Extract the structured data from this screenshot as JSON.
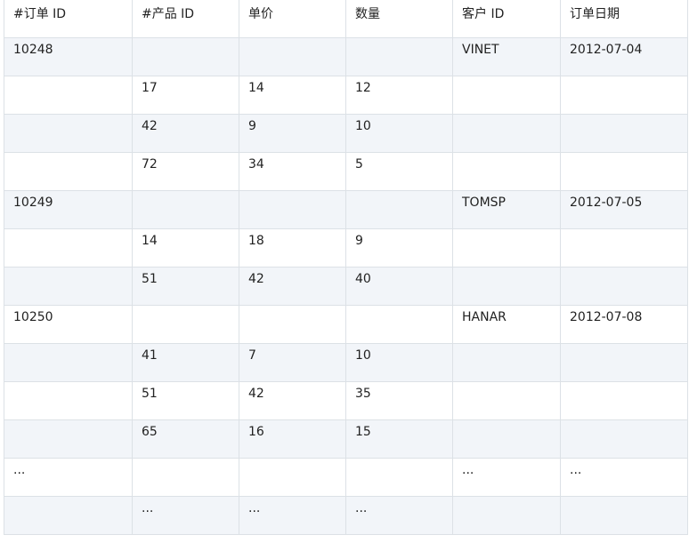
{
  "table": {
    "headers": [
      "#订单 ID",
      "#产品 ID",
      "单价",
      "数量",
      "客户 ID",
      "订单日期"
    ],
    "rows": [
      [
        "10248",
        "",
        "",
        "",
        "VINET",
        "2012-07-04"
      ],
      [
        "",
        "17",
        "14",
        "12",
        "",
        ""
      ],
      [
        "",
        "42",
        "9",
        "10",
        "",
        ""
      ],
      [
        "",
        "72",
        "34",
        "5",
        "",
        ""
      ],
      [
        "10249",
        "",
        "",
        "",
        "TOMSP",
        "2012-07-05"
      ],
      [
        "",
        "14",
        "18",
        "9",
        "",
        ""
      ],
      [
        "",
        "51",
        "42",
        "40",
        "",
        ""
      ],
      [
        "10250",
        "",
        "",
        "",
        "HANAR",
        "2012-07-08"
      ],
      [
        "",
        "41",
        "7",
        "10",
        "",
        ""
      ],
      [
        "",
        "51",
        "42",
        "35",
        "",
        ""
      ],
      [
        "",
        "65",
        "16",
        "15",
        "",
        ""
      ],
      [
        "...",
        "",
        "",
        "",
        "...",
        "..."
      ],
      [
        "",
        "...",
        "...",
        "...",
        "",
        ""
      ]
    ]
  },
  "colors": {
    "stripe": "#f2f5f9",
    "border": "#dce1e6",
    "text": "#222222"
  }
}
